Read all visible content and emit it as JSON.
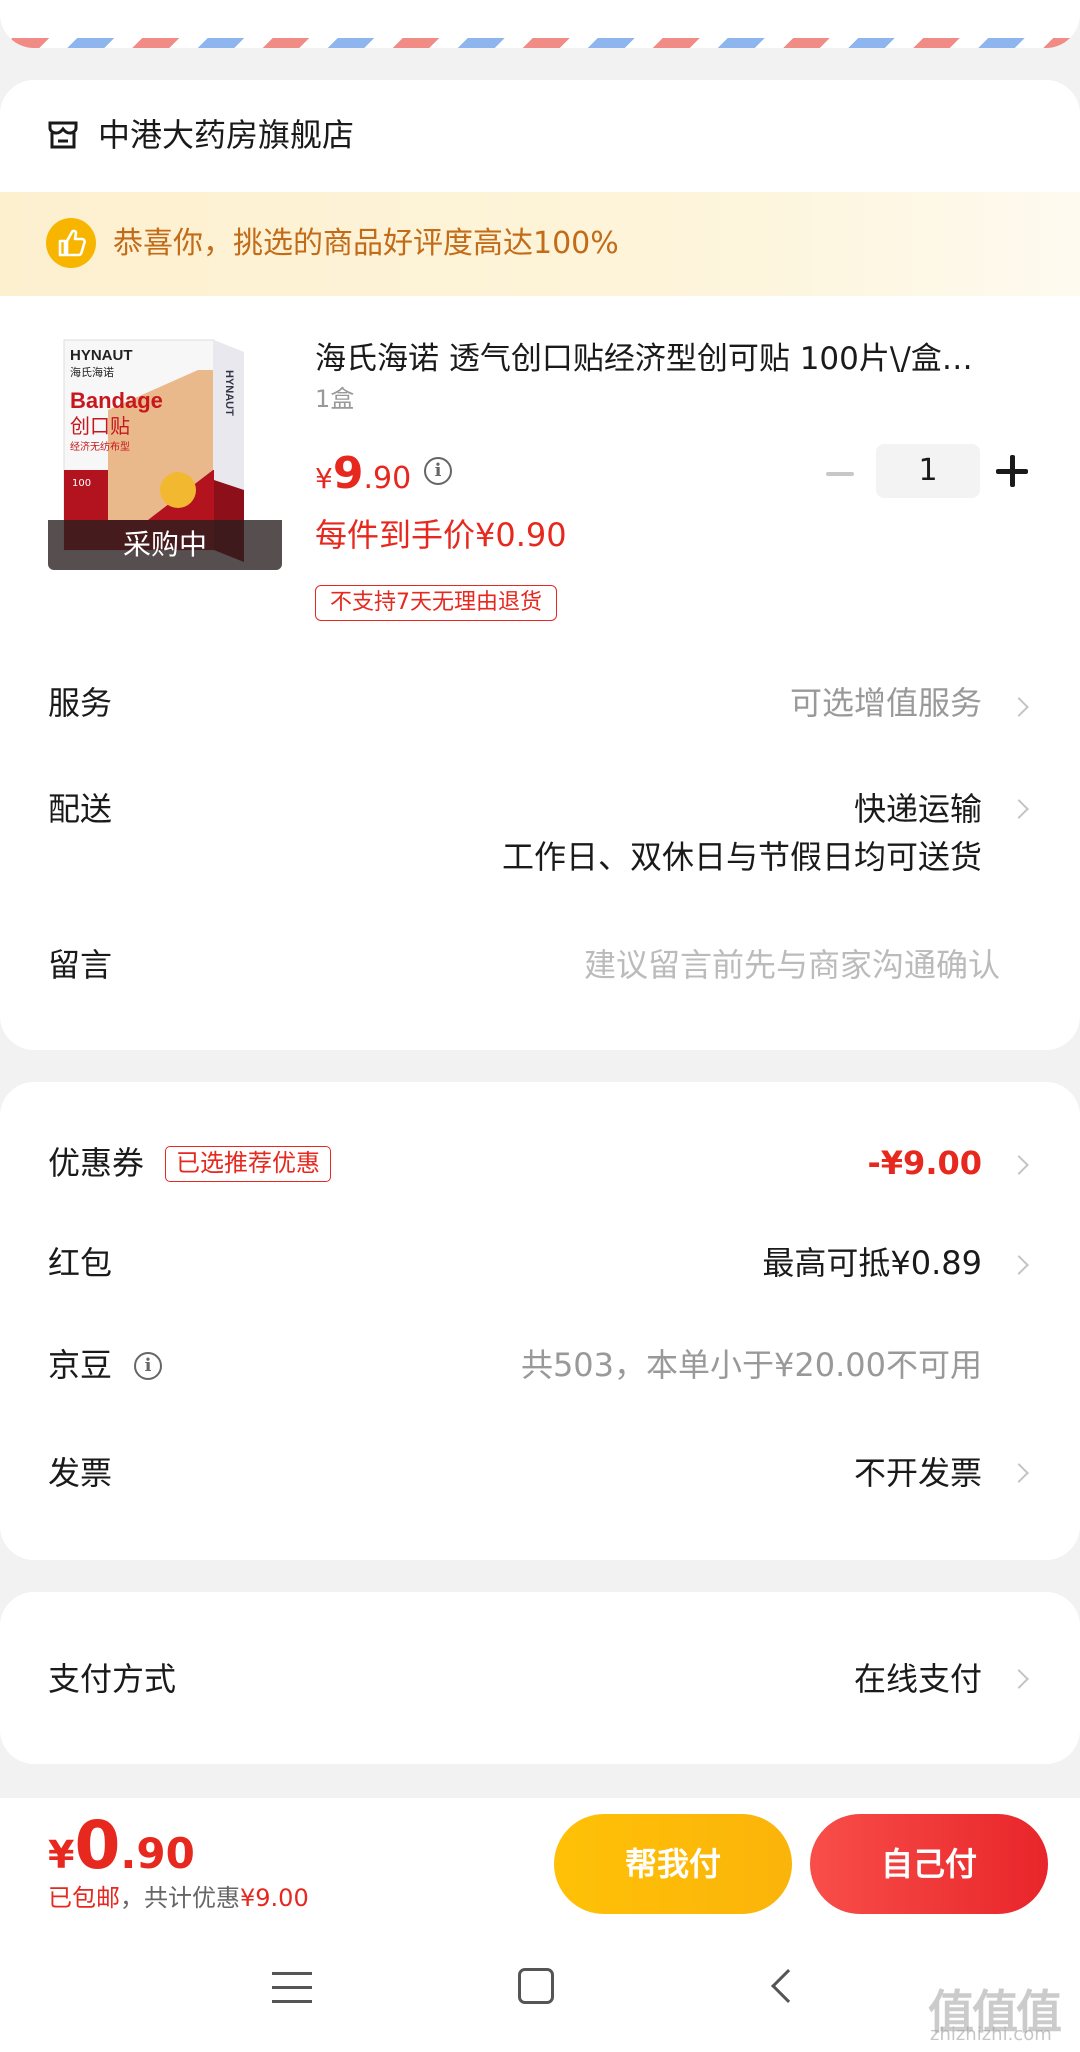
{
  "shop": {
    "name": "中港大药房旗舰店"
  },
  "banner": {
    "text": "恭喜你，挑选的商品好评度高达100%"
  },
  "product": {
    "title": "海氏海诺 透气创口贴经济型创可贴 100片\\/盒…",
    "spec": "1盒",
    "badge": "采购中",
    "price_yen": "¥",
    "price_int": "9",
    "price_dec": ".90",
    "per_price": "每件到手价¥0.90",
    "return_tag": "不支持7天无理由退货",
    "quantity": "1",
    "image": {
      "brand": "HYNAUT",
      "brand_cn": "海氏海诺",
      "name": "Bandage",
      "name_cn": "创口贴",
      "sub": "经济无纺布型",
      "count": "100"
    }
  },
  "rows": {
    "service": {
      "label": "服务",
      "value": "可选增值服务"
    },
    "delivery": {
      "label": "配送",
      "value": "快递运输",
      "note": "工作日、双休日与节假日均可送货"
    },
    "message": {
      "label": "留言",
      "placeholder": "建议留言前先与商家沟通确认"
    },
    "coupon": {
      "label": "优惠券",
      "tag": "已选推荐优惠",
      "value": "-¥9.00"
    },
    "redpacket": {
      "label": "红包",
      "value": "最高可抵¥0.89"
    },
    "jingdou": {
      "label": "京豆",
      "value": "共503，本单小于¥20.00不可用"
    },
    "invoice": {
      "label": "发票",
      "value": "不开发票"
    },
    "payment": {
      "label": "支付方式",
      "value": "在线支付"
    }
  },
  "footer": {
    "total_yen": "¥",
    "total_int": "0",
    "total_dec": ".90",
    "shipping": "已包邮",
    "discount_prefix": "，共计优惠",
    "discount": "¥9.00",
    "help_pay": "帮我付",
    "self_pay": "自己付"
  },
  "watermark": {
    "main": "值值值",
    "sub": "zhizhizhi.com"
  },
  "colors": {
    "accent": "#e6281e",
    "gold": "#f7b500",
    "banner_text": "#c26b18"
  }
}
